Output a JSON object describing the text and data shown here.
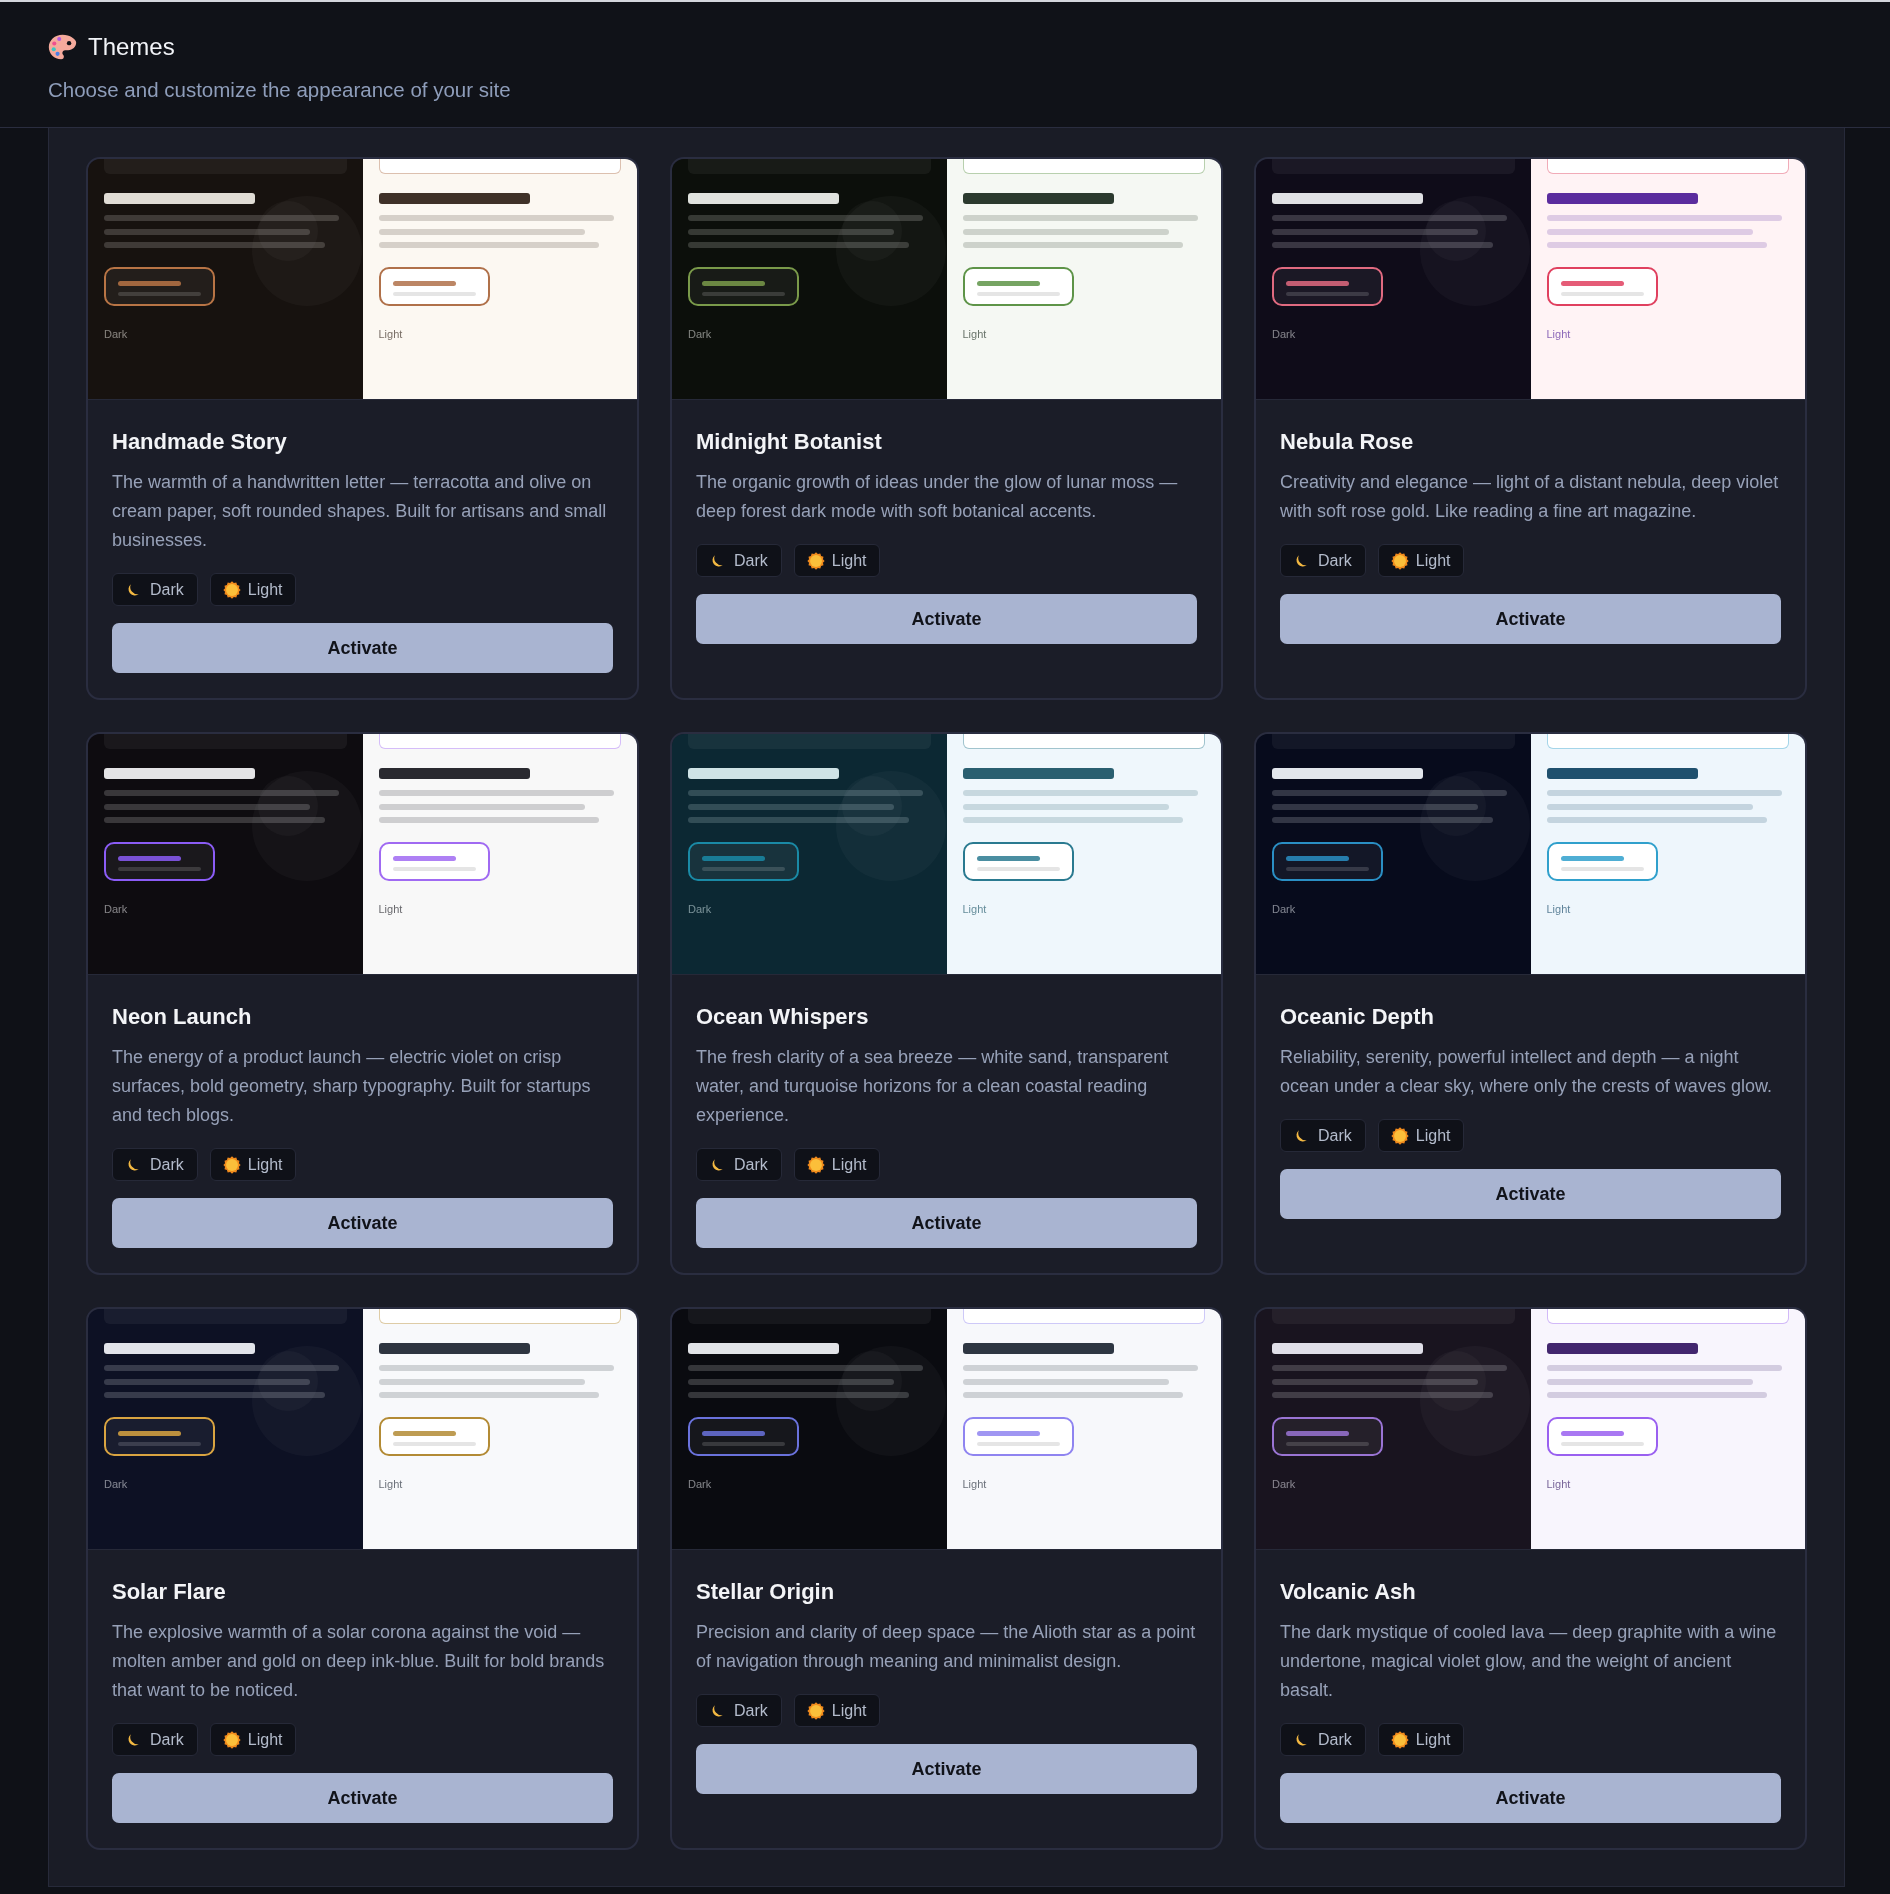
{
  "header": {
    "title": "Themes",
    "subtitle": "Choose and customize the appearance of your site"
  },
  "themes": [
    {
      "name": "Handmade Story",
      "description": "The warmth of a handwritten letter — terracotta and olive on cream paper, soft rounded shapes. Built for artisans and small businesses.",
      "previews": [
        {
          "kind": "dark",
          "label": "Dark",
          "color": "#17120f",
          "heading_bar": {
            "color": "#e0dcd5"
          },
          "mini_card": {
            "color": "#b87445"
          }
        },
        {
          "kind": "light",
          "label": "Light",
          "color": "#fcf8f2",
          "heading_bar": {
            "color": "#3f3128"
          },
          "mini_card": {
            "color": "#b0714a"
          }
        }
      ],
      "modes": [
        {
          "kind": "dark",
          "label": "Dark"
        },
        {
          "kind": "light",
          "label": "Light"
        }
      ],
      "action": "Activate"
    },
    {
      "name": "Midnight Botanist",
      "description": "The organic growth of ideas under the glow of lunar moss — deep forest dark mode with soft botanical accents.",
      "previews": [
        {
          "kind": "dark",
          "label": "Dark",
          "color": "#0c0f0b",
          "heading_bar": {
            "color": "#e0e2de"
          },
          "mini_card": {
            "color": "#7a9a4a"
          }
        },
        {
          "kind": "light",
          "label": "Light",
          "color": "#f5f8f3",
          "heading_bar": {
            "color": "#2b3a2e"
          },
          "mini_card": {
            "color": "#5e9448"
          }
        }
      ],
      "modes": [
        {
          "kind": "dark",
          "label": "Dark"
        },
        {
          "kind": "light",
          "label": "Light"
        }
      ],
      "action": "Activate"
    },
    {
      "name": "Nebula Rose",
      "description": "Creativity and elegance — light of a distant nebula, deep violet with soft rose gold. Like reading a fine art magazine.",
      "previews": [
        {
          "kind": "dark",
          "label": "Dark",
          "color": "#0f0c19",
          "heading_bar": {
            "color": "#e0e1e4"
          },
          "mini_card": {
            "color": "#e06a80"
          }
        },
        {
          "kind": "light",
          "label": "Light",
          "color": "#fff3f5",
          "heading_bar": {
            "color": "#5b2c9e"
          },
          "mini_card": {
            "color": "#e0405f"
          }
        }
      ],
      "modes": [
        {
          "kind": "dark",
          "label": "Dark"
        },
        {
          "kind": "light",
          "label": "Light"
        }
      ],
      "action": "Activate"
    },
    {
      "name": "Neon Launch",
      "description": "The energy of a product launch — electric violet on crisp surfaces, bold geometry, sharp typography. Built for startups and tech blogs.",
      "previews": [
        {
          "kind": "dark",
          "label": "Dark",
          "color": "#0e0c10",
          "heading_bar": {
            "color": "#e4e4e6"
          },
          "mini_card": {
            "color": "#8b5cf6"
          }
        },
        {
          "kind": "light",
          "label": "Light",
          "color": "#f8f8f8",
          "heading_bar": {
            "color": "#2a2a30"
          },
          "mini_card": {
            "color": "#a06af2"
          }
        }
      ],
      "modes": [
        {
          "kind": "dark",
          "label": "Dark"
        },
        {
          "kind": "light",
          "label": "Light"
        }
      ],
      "action": "Activate"
    },
    {
      "name": "Ocean Whispers",
      "description": "The fresh clarity of a sea breeze — white sand, transparent water, and turquoise horizons for a clean coastal reading experience.",
      "previews": [
        {
          "kind": "dark",
          "label": "Dark",
          "color": "#0c2833",
          "heading_bar": {
            "color": "#cfe3e6"
          },
          "mini_card": {
            "color": "#1a8aa6"
          }
        },
        {
          "kind": "light",
          "label": "Light",
          "color": "#eff7fc",
          "heading_bar": {
            "color": "#2a5f70"
          },
          "mini_card": {
            "color": "#2a7a90"
          }
        }
      ],
      "modes": [
        {
          "kind": "dark",
          "label": "Dark"
        },
        {
          "kind": "light",
          "label": "Light"
        }
      ],
      "action": "Activate"
    },
    {
      "name": "Oceanic Depth",
      "description": "Reliability, serenity, powerful intellect and depth — a night ocean under a clear sky, where only the crests of waves glow.",
      "previews": [
        {
          "kind": "dark",
          "label": "Dark",
          "color": "#070b1c",
          "heading_bar": {
            "color": "#e2e6ec"
          },
          "mini_card": {
            "color": "#2a8fc4"
          }
        },
        {
          "kind": "light",
          "label": "Light",
          "color": "#eef6fc",
          "heading_bar": {
            "color": "#1f506e"
          },
          "mini_card": {
            "color": "#30a0cc"
          }
        }
      ],
      "modes": [
        {
          "kind": "dark",
          "label": "Dark"
        },
        {
          "kind": "light",
          "label": "Light"
        }
      ],
      "action": "Activate"
    },
    {
      "name": "Solar Flare",
      "description": "The explosive warmth of a solar corona against the void — molten amber and gold on deep ink-blue. Built for bold brands that want to be noticed.",
      "previews": [
        {
          "kind": "dark",
          "label": "Dark",
          "color": "#0d1124",
          "heading_bar": {
            "color": "#e2e4ea"
          },
          "mini_card": {
            "color": "#d9a441"
          }
        },
        {
          "kind": "light",
          "label": "Light",
          "color": "#f8f9fb",
          "heading_bar": {
            "color": "#2e3540"
          },
          "mini_card": {
            "color": "#b38b35"
          }
        }
      ],
      "modes": [
        {
          "kind": "dark",
          "label": "Dark"
        },
        {
          "kind": "light",
          "label": "Light"
        }
      ],
      "action": "Activate"
    },
    {
      "name": "Stellar Origin",
      "description": "Precision and clarity of deep space — the Alioth star as a point of navigation through meaning and minimalist design.",
      "previews": [
        {
          "kind": "dark",
          "label": "Dark",
          "color": "#0a0b10",
          "heading_bar": {
            "color": "#e2e4e8"
          },
          "mini_card": {
            "color": "#6a72dc"
          }
        },
        {
          "kind": "light",
          "label": "Light",
          "color": "#f7f8fb",
          "heading_bar": {
            "color": "#2e3642"
          },
          "mini_card": {
            "color": "#8f84f0"
          }
        }
      ],
      "modes": [
        {
          "kind": "dark",
          "label": "Dark"
        },
        {
          "kind": "light",
          "label": "Light"
        }
      ],
      "action": "Activate"
    },
    {
      "name": "Volcanic Ash",
      "description": "The dark mystique of cooled lava — deep graphite with a wine undertone, magical violet glow, and the weight of ancient basalt.",
      "previews": [
        {
          "kind": "dark",
          "label": "Dark",
          "color": "#19141f",
          "heading_bar": {
            "color": "#e0dfe8"
          },
          "mini_card": {
            "color": "#9a74d4"
          }
        },
        {
          "kind": "light",
          "label": "Light",
          "color": "#f8f5fd",
          "heading_bar": {
            "color": "#42266e"
          },
          "mini_card": {
            "color": "#9a60f0"
          }
        }
      ],
      "modes": [
        {
          "kind": "dark",
          "label": "Dark"
        },
        {
          "kind": "light",
          "label": "Light"
        }
      ],
      "action": "Activate"
    }
  ]
}
